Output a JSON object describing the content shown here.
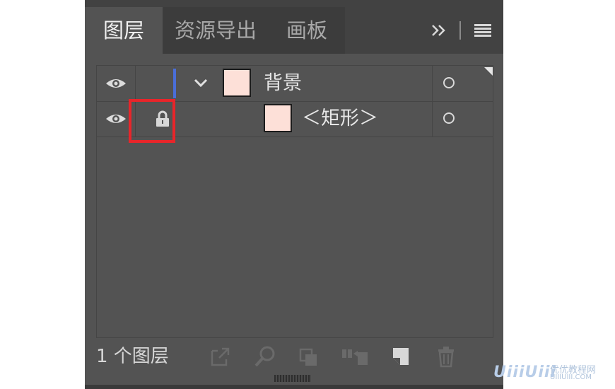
{
  "tabs": [
    {
      "label": "图层",
      "active": true
    },
    {
      "label": "资源导出",
      "active": false
    },
    {
      "label": "画板",
      "active": false
    }
  ],
  "tab_icons": {
    "more": "double-chevron-right-icon",
    "menu": "hamburger-menu-icon"
  },
  "layers": [
    {
      "name": "背景",
      "expanded": true,
      "locked": false,
      "visible": true,
      "type": "layer",
      "thumb_color": "#fde0d8"
    },
    {
      "name": "＜矩形＞",
      "expanded": false,
      "locked": true,
      "visible": true,
      "type": "sublayer",
      "thumb_color": "#fde0d8"
    }
  ],
  "footer": {
    "layer_count": "1 个图层"
  },
  "footer_icons": [
    "export-icon",
    "search-icon",
    "collect-icon",
    "move-selection-icon",
    "new-layer-icon",
    "delete-icon"
  ],
  "colors": {
    "panel_bg": "#535353",
    "tab_bar": "#424242",
    "layer_color_bar": "#4a6ed8",
    "highlight": "#e8252a",
    "thumb": "#fde0d8"
  },
  "watermark": {
    "logo": "UiiiUiii",
    "name": "优优教程网",
    "domain": "UIIIUIII.COM"
  }
}
